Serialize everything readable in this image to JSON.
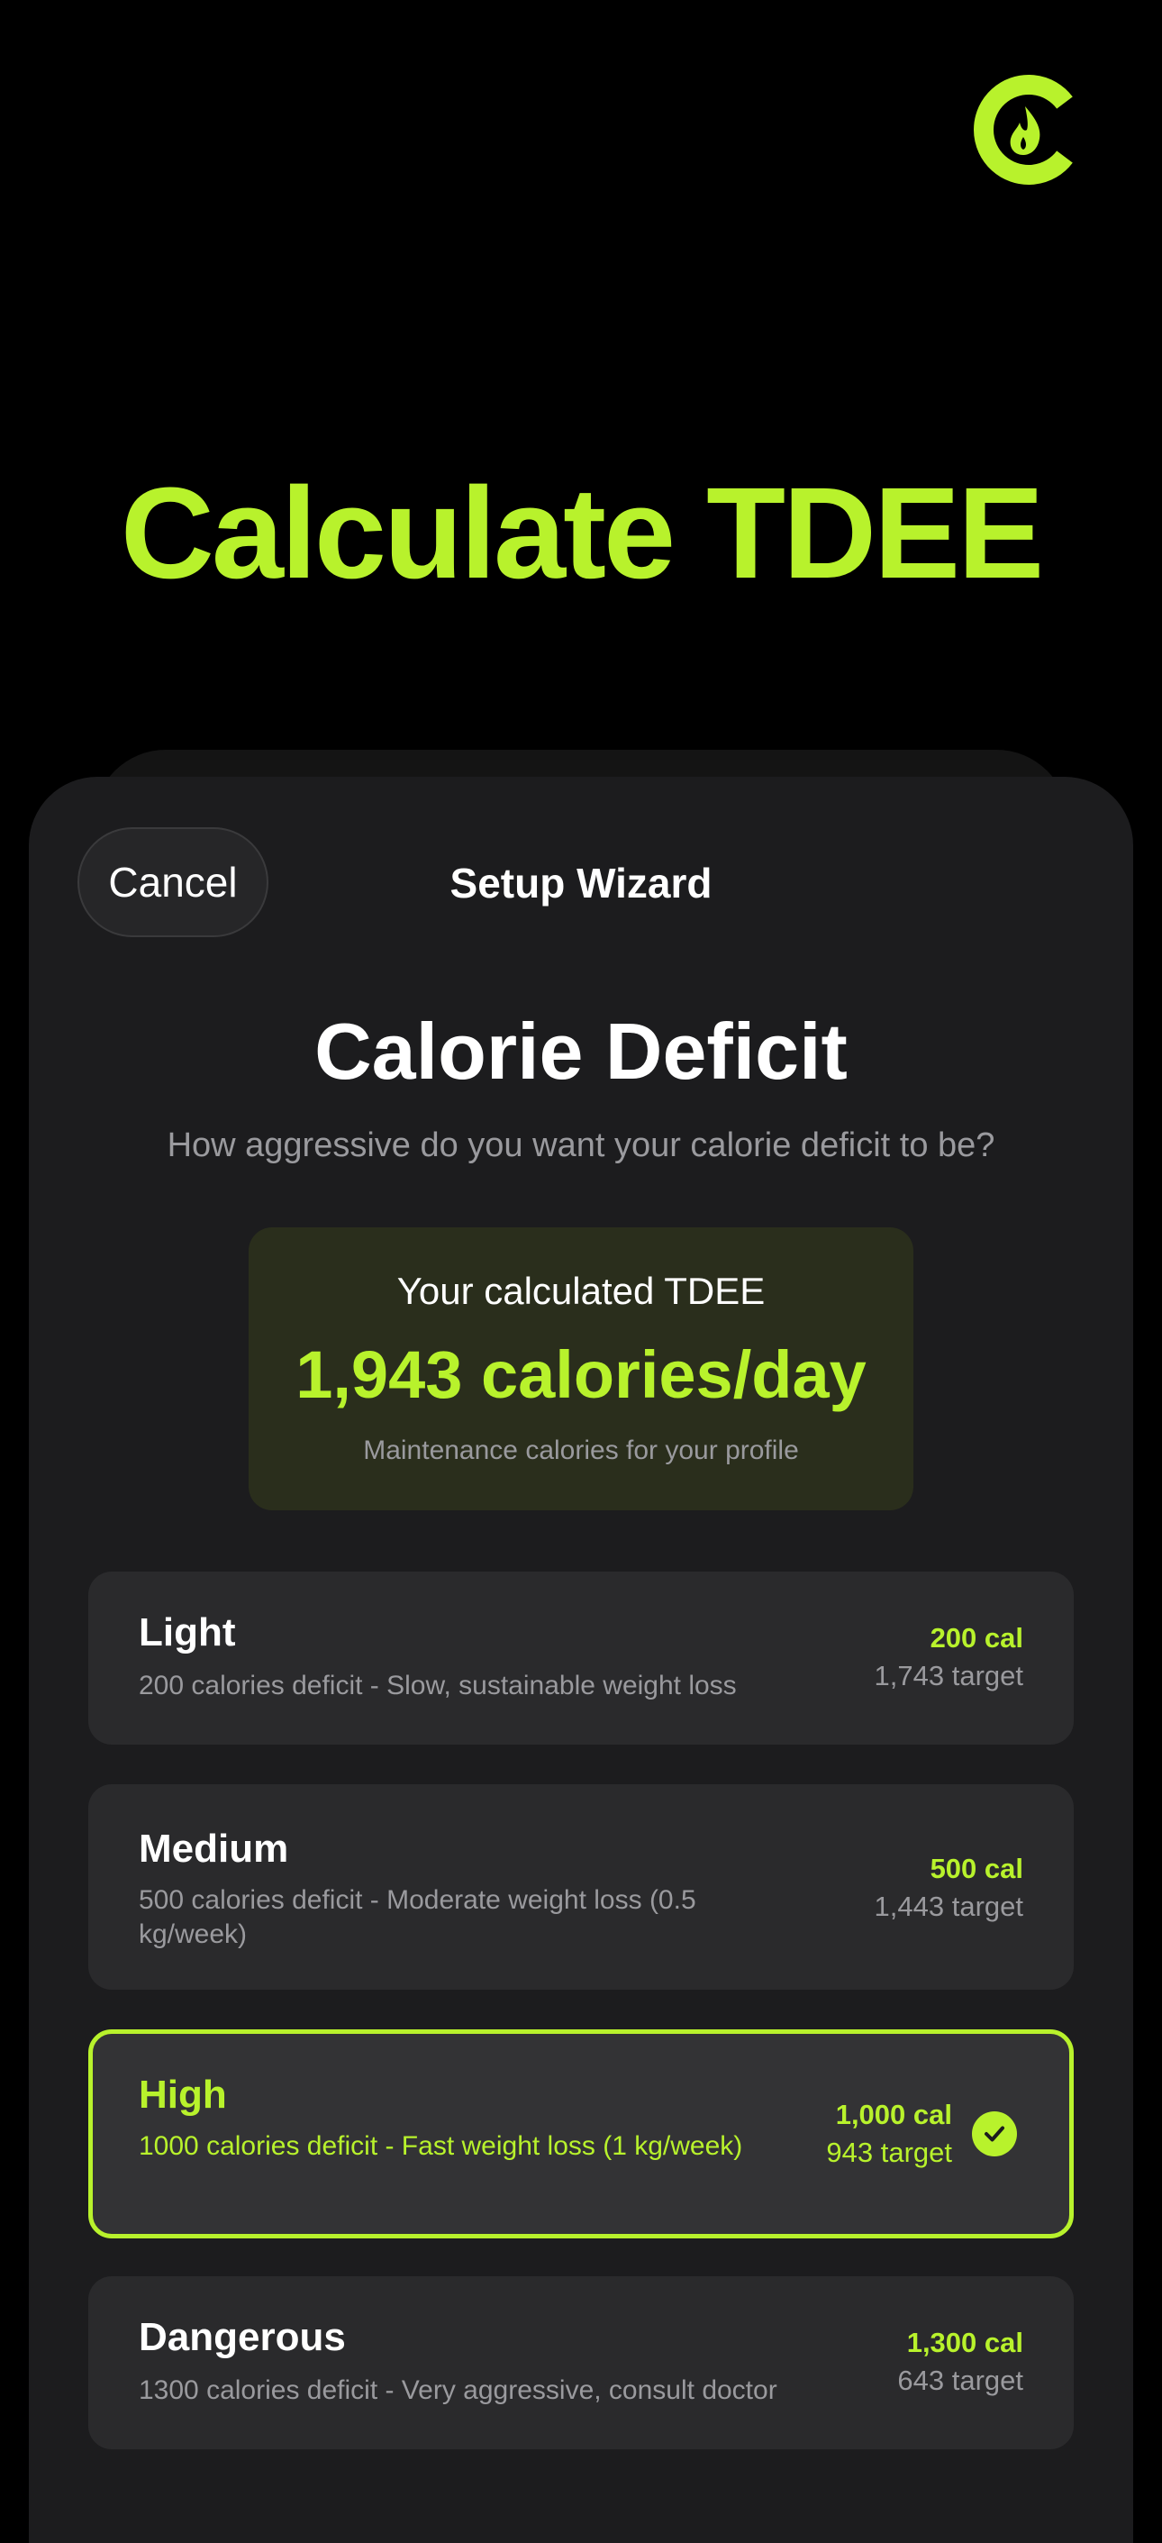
{
  "brand": {
    "accent_color": "#b8f22c",
    "logo_icon": "flame-logo-icon"
  },
  "hero": {
    "title": "Calculate TDEE"
  },
  "header": {
    "cancel_label": "Cancel",
    "title": "Setup Wizard"
  },
  "main": {
    "title": "Calorie Deficit",
    "subtitle": "How aggressive do you want your calorie deficit to be?"
  },
  "tdee": {
    "label": "Your calculated TDEE",
    "value": "1,943 calories/day",
    "note": "Maintenance calories for your profile"
  },
  "options": [
    {
      "name": "Light",
      "description": "200 calories deficit - Slow, sustainable weight loss",
      "calories": "200 cal",
      "target": "1,743 target",
      "selected": false
    },
    {
      "name": "Medium",
      "description": "500 calories deficit - Moderate weight loss (0.5 kg/week)",
      "calories": "500 cal",
      "target": "1,443 target",
      "selected": false
    },
    {
      "name": "High",
      "description": "1000 calories deficit - Fast weight loss (1 kg/week)",
      "calories": "1,000 cal",
      "target": "943 target",
      "selected": true
    },
    {
      "name": "Dangerous",
      "description": "1300 calories deficit - Very aggressive, consult doctor",
      "calories": "1,300 cal",
      "target": "643 target",
      "selected": false
    }
  ]
}
